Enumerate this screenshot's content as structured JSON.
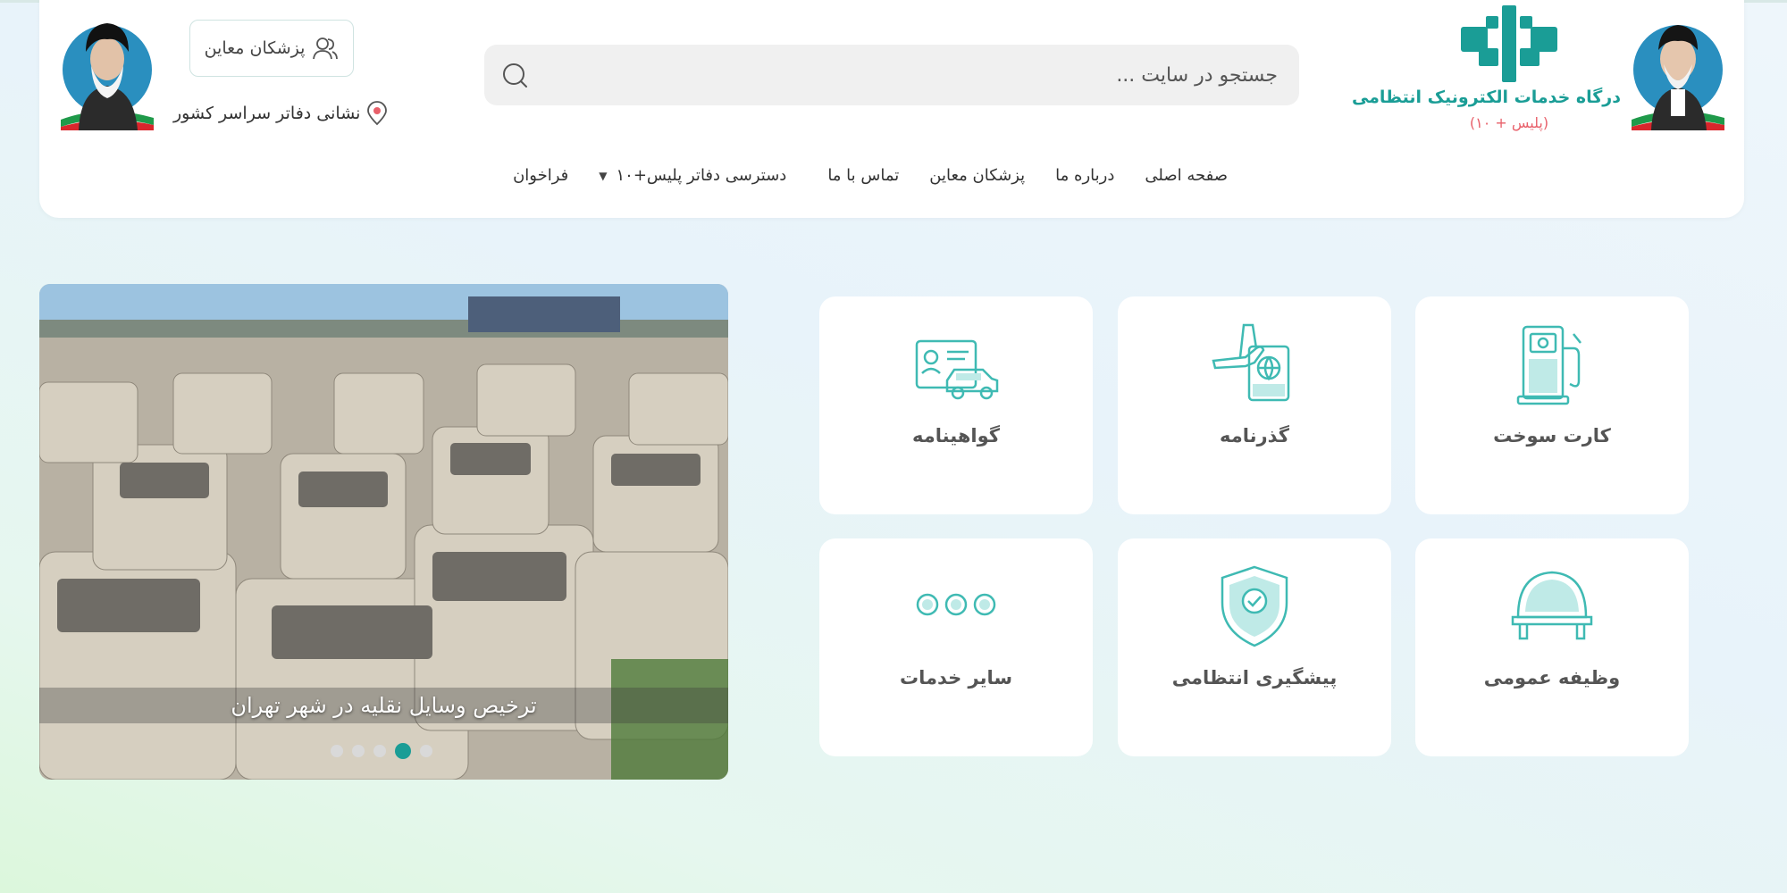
{
  "header": {
    "brand_title": "درگاه خدمات الکترونیک انتظامی",
    "brand_subtitle": "(پلیس + ۱۰)",
    "search_placeholder": "جستجو در سایت ...",
    "doctors_button": "پزشکان معاین",
    "offices_link": "نشانی دفاتر سراسر کشور"
  },
  "nav": [
    {
      "label": "صفحه اصلی"
    },
    {
      "label": "درباره ما"
    },
    {
      "label": "پزشکان معاین"
    },
    {
      "label": "تماس با ما"
    },
    {
      "label": "دسترسی دفاتر پلیس+۱۰"
    },
    {
      "label": "فراخوان"
    }
  ],
  "slider": {
    "caption": "ترخیص وسایل نقلیه در شهر تهران",
    "slide_count": 5,
    "active_slide": 4
  },
  "services": [
    {
      "label": "کارت سوخت",
      "icon": "fuel-pump-icon"
    },
    {
      "label": "گذرنامه",
      "icon": "passport-icon"
    },
    {
      "label": "گواهینامه",
      "icon": "driving-license-icon"
    },
    {
      "label": "وظیفه عمومی",
      "icon": "military-helmet-icon"
    },
    {
      "label": "پیشگیری انتظامی",
      "icon": "shield-icon"
    },
    {
      "label": "سایر خدمات",
      "icon": "more-services-icon"
    }
  ],
  "colors": {
    "accent": "#1a9d96",
    "icon": "#4fc3bd",
    "subtitle": "#e8606a"
  }
}
